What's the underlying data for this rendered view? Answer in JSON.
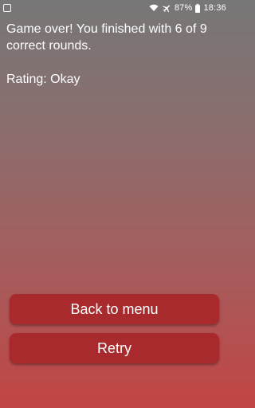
{
  "status_bar": {
    "battery_percent": "87%",
    "time": "18:36",
    "icons": [
      "notification-icon",
      "wifi-icon",
      "airplane-mode-icon",
      "battery-icon"
    ]
  },
  "result": {
    "message": "Game over! You finished with 6 of 9 correct rounds.",
    "rating": "Rating: Okay"
  },
  "buttons": {
    "back_to_menu": "Back to menu",
    "retry": "Retry"
  },
  "colors": {
    "button_bg": "#a82a2d",
    "text": "#ffffff"
  }
}
